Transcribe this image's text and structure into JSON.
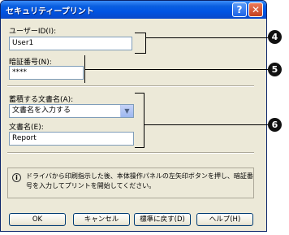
{
  "window": {
    "title": "セキュリティープリント",
    "help_glyph": "?",
    "close_glyph": "✕"
  },
  "user_id": {
    "label": "ユーザーID(I):",
    "value": "User1"
  },
  "pin": {
    "label": "暗証番号(N):",
    "value": "****"
  },
  "store_doc": {
    "label": "蓄積する文書名(A):",
    "value": "文書名を入力する"
  },
  "doc_name": {
    "label": "文書名(E):",
    "value": "Report"
  },
  "info": {
    "icon_glyph": "i",
    "text": "ドライバから印刷指示した後、本体操作パネルの左矢印ボタンを押し、暗証番号を入力してプリントを開始してください。"
  },
  "buttons": {
    "ok": "OK",
    "cancel": "キャンセル",
    "reset": "標準に戻す(D)",
    "help": "ヘルプ(H)"
  },
  "callouts": {
    "c4": "4",
    "c5": "5",
    "c6": "6"
  }
}
